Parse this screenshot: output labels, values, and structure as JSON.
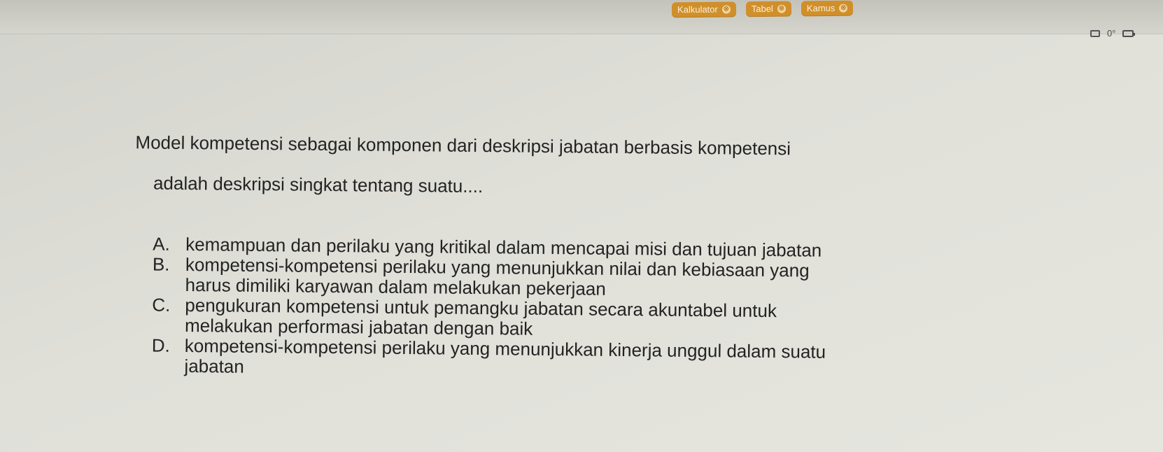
{
  "top_tools": {
    "kalkulator": "Kalkulator",
    "tabel": "Tabel",
    "kamus": "Kamus",
    "close_glyph": "⊗"
  },
  "status": {
    "zoom": "0°"
  },
  "question": {
    "line1": "Model kompetensi sebagai komponen dari deskripsi jabatan berbasis kompetensi",
    "line2": "adalah deskripsi singkat tentang suatu...."
  },
  "options": [
    {
      "letter": "A.",
      "text": "kemampuan dan perilaku yang kritikal dalam mencapai misi dan tujuan jabatan"
    },
    {
      "letter": "B.",
      "text": "kompetensi-kompetensi perilaku yang menunjukkan nilai dan kebiasaan yang\nharus dimiliki karyawan dalam melakukan pekerjaan"
    },
    {
      "letter": "C.",
      "text": "pengukuran kompetensi untuk pemangku jabatan secara akuntabel untuk\nmelakukan performasi jabatan dengan baik"
    },
    {
      "letter": "D.",
      "text": "kompetensi-kompetensi perilaku yang menunjukkan kinerja unggul dalam suatu\njabatan"
    }
  ],
  "colors": {
    "tab_bg": "#d08f2a",
    "tab_text": "#f8efd6",
    "page_bg": "#e0e0d9",
    "text": "#232323"
  },
  "icons": {
    "monitor": "monitor-icon",
    "battery": "battery-icon",
    "close": "close-icon"
  }
}
